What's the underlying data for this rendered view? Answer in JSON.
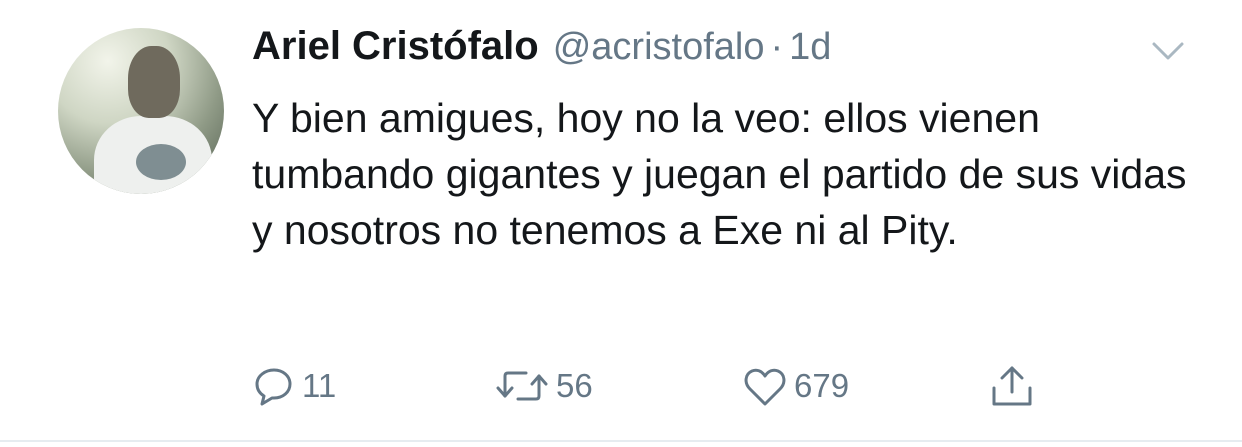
{
  "tweet": {
    "author_name": "Ariel Cristófalo",
    "handle": "@acristofalo",
    "separator": "·",
    "time": "1d",
    "text": "Y bien amigues, hoy no la veo: ellos vienen tumbando gigantes y juegan el partido de sus vidas y nosotros no tenemos a Exe ni al Pity.",
    "replies": "11",
    "retweets": "56",
    "likes": "679"
  },
  "icons": {
    "caret": "chevron-down-icon",
    "reply": "reply-icon",
    "retweet": "retweet-icon",
    "like": "heart-icon",
    "share": "share-icon"
  },
  "colors": {
    "text": "#14171a",
    "secondary": "#657786",
    "divider": "#e6ecf0",
    "caret": "#aab8c2"
  }
}
